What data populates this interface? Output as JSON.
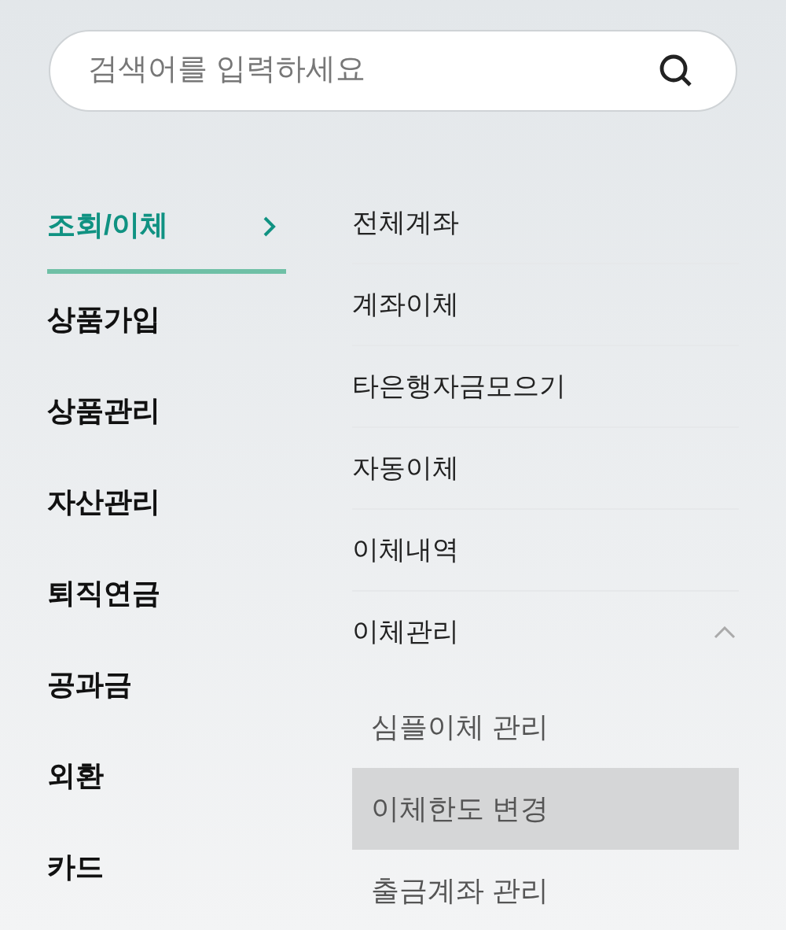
{
  "search": {
    "placeholder": "검색어를 입력하세요"
  },
  "categories": [
    {
      "label": "조회/이체",
      "selected": true
    },
    {
      "label": "상품가입",
      "selected": false
    },
    {
      "label": "상품관리",
      "selected": false
    },
    {
      "label": "자산관리",
      "selected": false
    },
    {
      "label": "퇴직연금",
      "selected": false
    },
    {
      "label": "공과금",
      "selected": false
    },
    {
      "label": "외환",
      "selected": false
    },
    {
      "label": "카드",
      "selected": false
    }
  ],
  "menu": [
    {
      "label": "전체계좌"
    },
    {
      "label": "계좌이체"
    },
    {
      "label": "타은행자금모으기"
    },
    {
      "label": "자동이체"
    },
    {
      "label": "이체내역"
    },
    {
      "label": "이체관리",
      "expanded": true,
      "children": [
        {
          "label": "심플이체 관리",
          "selected": false
        },
        {
          "label": "이체한도 변경",
          "selected": true
        },
        {
          "label": "출금계좌 관리",
          "selected": false
        }
      ]
    }
  ]
}
